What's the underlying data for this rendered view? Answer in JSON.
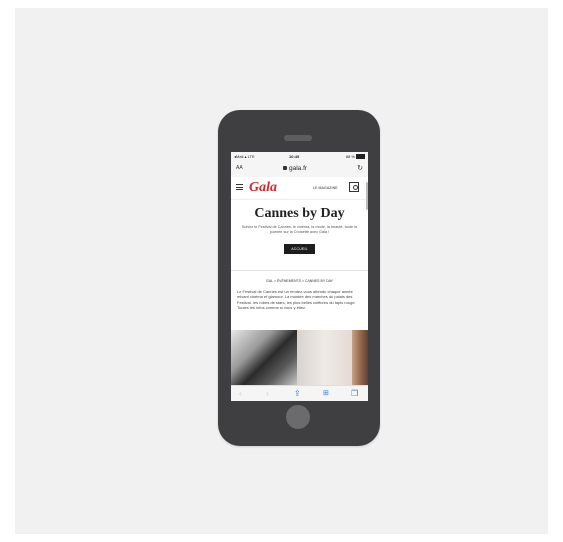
{
  "status_bar": {
    "carrier": "Mail",
    "network": "LTE",
    "time": "10:49",
    "battery": "88 %"
  },
  "browser": {
    "text_size_label": "AA",
    "url": "gala.fr",
    "reload_icon": "reload-icon"
  },
  "site": {
    "logo": "Gala",
    "magazine_label": "LE MAGAZINE",
    "hero": {
      "title": "Cannes by Day",
      "subtitle": "Suivez le Festival de Cannes, le cinéma, la mode, la beauté, toute la journée sur la Croisette avec Gala !",
      "button": "ACCUEIL"
    },
    "breadcrumb": "GAL > ÉVÉNEMENTS > CANNES BY DAY",
    "intro": "Le Festival de Cannes est un rendez-vous attendu chaque année mixant cinéma et glamour. La montée des marches du palais des Festival, les robes de stars, les plus belles coiffures du tapis rouge. Toutes les infos comme si vous y étiez."
  },
  "toolbar": {
    "back": "‹",
    "forward": "›",
    "share": "⇪",
    "bookmarks": "📖",
    "tabs": "❐"
  }
}
